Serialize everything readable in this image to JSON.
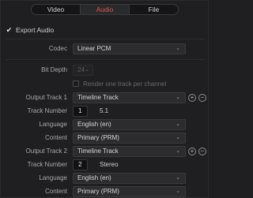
{
  "tabs": [
    {
      "label": "Video",
      "active": false
    },
    {
      "label": "Audio",
      "active": true
    },
    {
      "label": "File",
      "active": false
    }
  ],
  "export_audio": {
    "label": "Export Audio",
    "checked": true,
    "check_glyph": "✔"
  },
  "codec": {
    "label": "Codec",
    "value": "Linear PCM"
  },
  "bit_depth": {
    "label": "Bit Depth",
    "value": "24"
  },
  "render_one_track": {
    "label": "Render one track per channel",
    "checked": false
  },
  "output_track_1": {
    "label": "Output Track 1",
    "value": "Timeline Track",
    "track_number_label": "Track Number",
    "track_number": "1",
    "track_format": "5.1",
    "language_label": "Language",
    "language": "English (en)",
    "content_label": "Content",
    "content": "Primary (PRM)"
  },
  "output_track_2": {
    "label": "Output Track 2",
    "value": "Timeline Track",
    "track_number_label": "Track Number",
    "track_number": "2",
    "track_format": "Stereo",
    "language_label": "Language",
    "language": "English (en)",
    "content_label": "Content",
    "content": "Primary (PRM)"
  },
  "icons": {
    "chevron": "⌄",
    "add": "+",
    "remove": "−"
  },
  "colors": {
    "accent": "#e2534a",
    "background": "#1f1f21"
  }
}
